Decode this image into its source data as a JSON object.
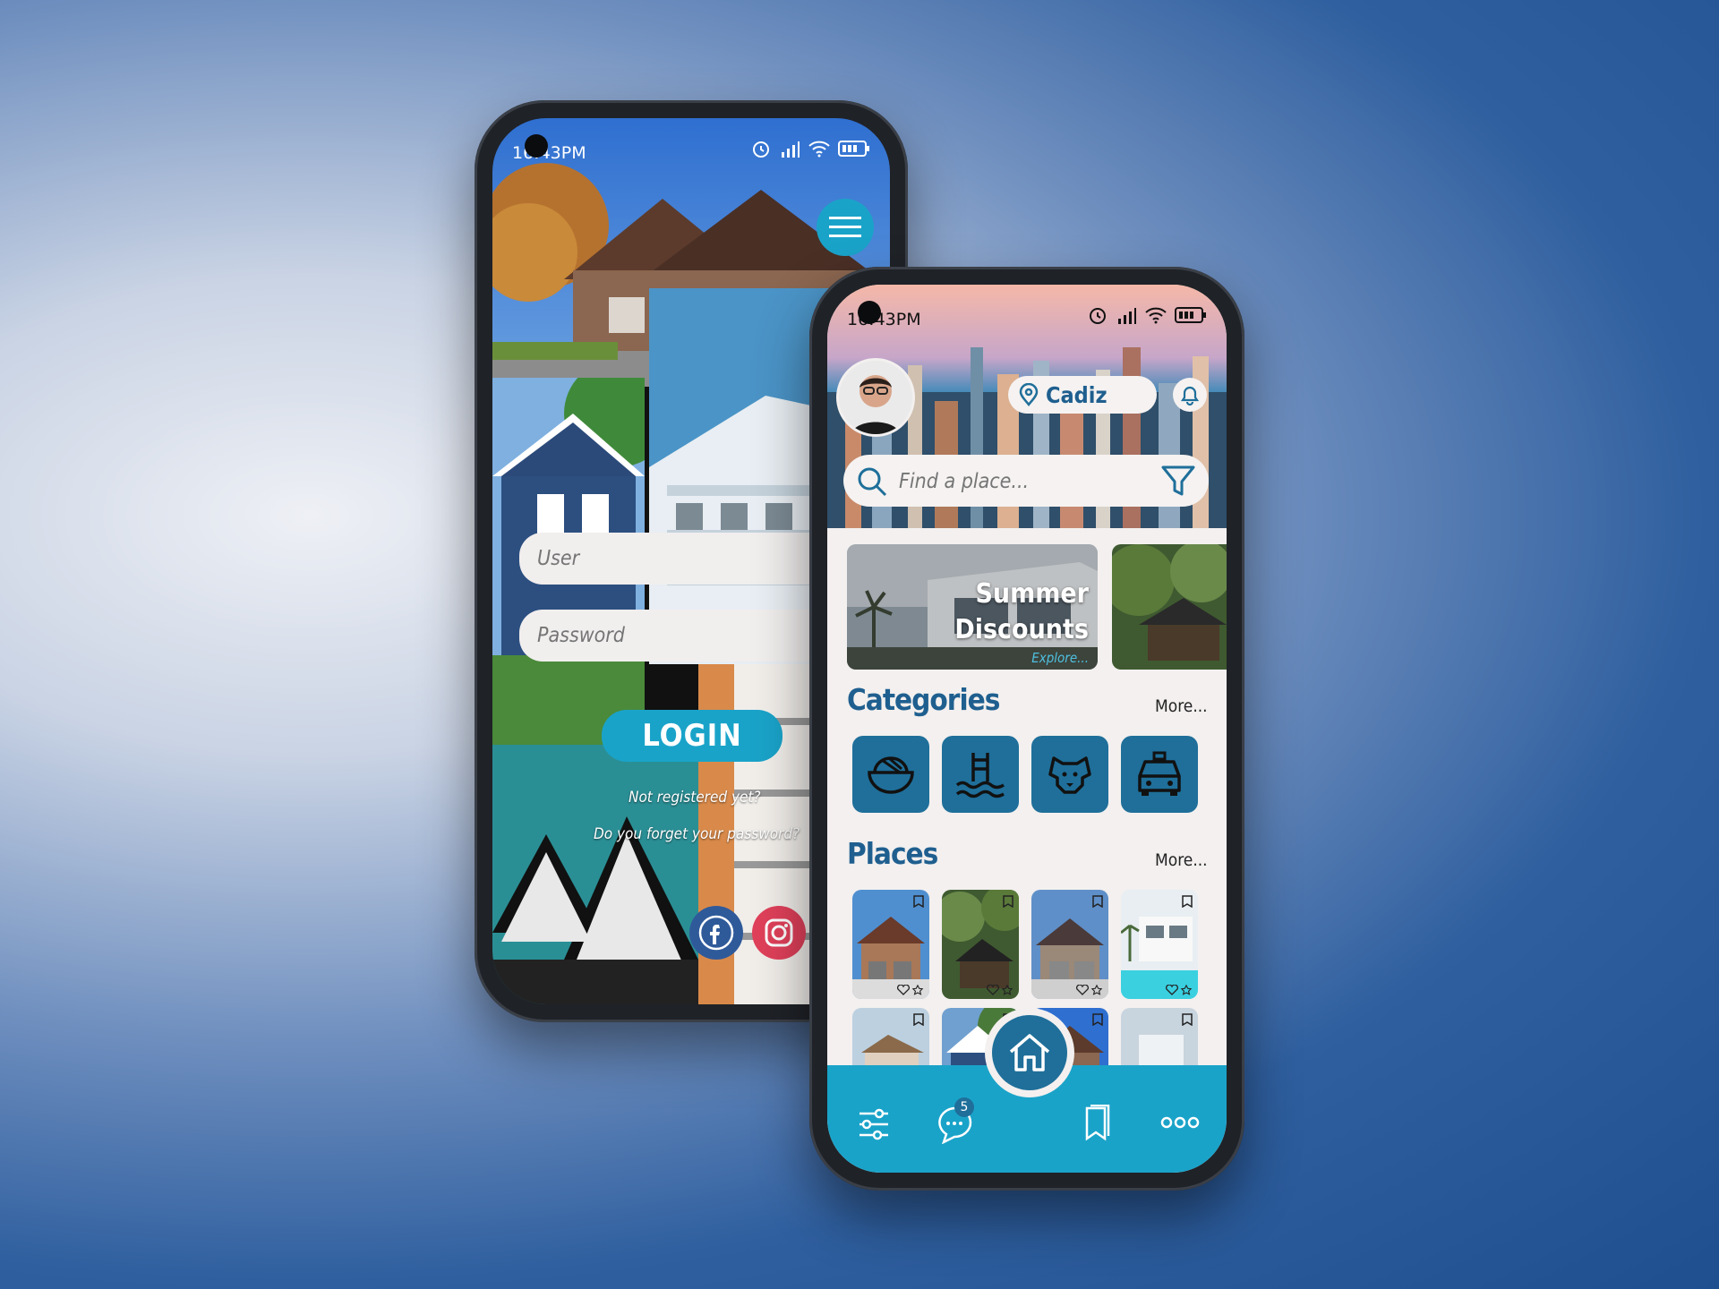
{
  "login_screen": {
    "status_time": "16:43PM",
    "user_placeholder": "User",
    "password_placeholder": "Password",
    "login_label": "LOGIN",
    "not_registered": "Not registered yet?",
    "forgot_password": "Do you forget your password?"
  },
  "home_screen": {
    "status_time": "16:43PM",
    "location": "Cadiz",
    "search_placeholder": "Find a place...",
    "banner_title_line1": "Summer",
    "banner_title_line2": "Discounts",
    "banner_link": "Explore...",
    "categories_heading": "Categories",
    "places_heading": "Places",
    "more_label": "More...",
    "categories": [
      {
        "icon": "food-bowl-icon"
      },
      {
        "icon": "pool-icon"
      },
      {
        "icon": "dog-icon"
      },
      {
        "icon": "taxi-icon"
      }
    ],
    "chat_badge": "5"
  },
  "colors": {
    "accent": "#1aa3c9",
    "primary_dark": "#1f6f9a",
    "heading": "#1f5f8f",
    "instagram": "#e0405a",
    "facebook": "#2f5a9a"
  }
}
